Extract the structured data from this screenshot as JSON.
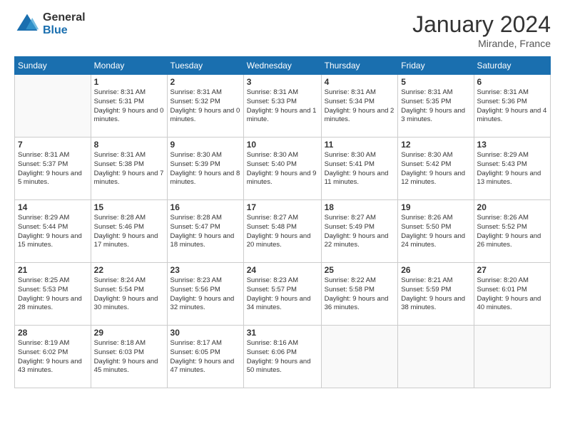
{
  "header": {
    "logo_general": "General",
    "logo_blue": "Blue",
    "month_title": "January 2024",
    "location": "Mirande, France"
  },
  "weekdays": [
    "Sunday",
    "Monday",
    "Tuesday",
    "Wednesday",
    "Thursday",
    "Friday",
    "Saturday"
  ],
  "weeks": [
    [
      {
        "day": "",
        "sunrise": "",
        "sunset": "",
        "daylight": ""
      },
      {
        "day": "1",
        "sunrise": "Sunrise: 8:31 AM",
        "sunset": "Sunset: 5:31 PM",
        "daylight": "Daylight: 9 hours and 0 minutes."
      },
      {
        "day": "2",
        "sunrise": "Sunrise: 8:31 AM",
        "sunset": "Sunset: 5:32 PM",
        "daylight": "Daylight: 9 hours and 0 minutes."
      },
      {
        "day": "3",
        "sunrise": "Sunrise: 8:31 AM",
        "sunset": "Sunset: 5:33 PM",
        "daylight": "Daylight: 9 hours and 1 minute."
      },
      {
        "day": "4",
        "sunrise": "Sunrise: 8:31 AM",
        "sunset": "Sunset: 5:34 PM",
        "daylight": "Daylight: 9 hours and 2 minutes."
      },
      {
        "day": "5",
        "sunrise": "Sunrise: 8:31 AM",
        "sunset": "Sunset: 5:35 PM",
        "daylight": "Daylight: 9 hours and 3 minutes."
      },
      {
        "day": "6",
        "sunrise": "Sunrise: 8:31 AM",
        "sunset": "Sunset: 5:36 PM",
        "daylight": "Daylight: 9 hours and 4 minutes."
      }
    ],
    [
      {
        "day": "7",
        "sunrise": "Sunrise: 8:31 AM",
        "sunset": "Sunset: 5:37 PM",
        "daylight": "Daylight: 9 hours and 5 minutes."
      },
      {
        "day": "8",
        "sunrise": "Sunrise: 8:31 AM",
        "sunset": "Sunset: 5:38 PM",
        "daylight": "Daylight: 9 hours and 7 minutes."
      },
      {
        "day": "9",
        "sunrise": "Sunrise: 8:30 AM",
        "sunset": "Sunset: 5:39 PM",
        "daylight": "Daylight: 9 hours and 8 minutes."
      },
      {
        "day": "10",
        "sunrise": "Sunrise: 8:30 AM",
        "sunset": "Sunset: 5:40 PM",
        "daylight": "Daylight: 9 hours and 9 minutes."
      },
      {
        "day": "11",
        "sunrise": "Sunrise: 8:30 AM",
        "sunset": "Sunset: 5:41 PM",
        "daylight": "Daylight: 9 hours and 11 minutes."
      },
      {
        "day": "12",
        "sunrise": "Sunrise: 8:30 AM",
        "sunset": "Sunset: 5:42 PM",
        "daylight": "Daylight: 9 hours and 12 minutes."
      },
      {
        "day": "13",
        "sunrise": "Sunrise: 8:29 AM",
        "sunset": "Sunset: 5:43 PM",
        "daylight": "Daylight: 9 hours and 13 minutes."
      }
    ],
    [
      {
        "day": "14",
        "sunrise": "Sunrise: 8:29 AM",
        "sunset": "Sunset: 5:44 PM",
        "daylight": "Daylight: 9 hours and 15 minutes."
      },
      {
        "day": "15",
        "sunrise": "Sunrise: 8:28 AM",
        "sunset": "Sunset: 5:46 PM",
        "daylight": "Daylight: 9 hours and 17 minutes."
      },
      {
        "day": "16",
        "sunrise": "Sunrise: 8:28 AM",
        "sunset": "Sunset: 5:47 PM",
        "daylight": "Daylight: 9 hours and 18 minutes."
      },
      {
        "day": "17",
        "sunrise": "Sunrise: 8:27 AM",
        "sunset": "Sunset: 5:48 PM",
        "daylight": "Daylight: 9 hours and 20 minutes."
      },
      {
        "day": "18",
        "sunrise": "Sunrise: 8:27 AM",
        "sunset": "Sunset: 5:49 PM",
        "daylight": "Daylight: 9 hours and 22 minutes."
      },
      {
        "day": "19",
        "sunrise": "Sunrise: 8:26 AM",
        "sunset": "Sunset: 5:50 PM",
        "daylight": "Daylight: 9 hours and 24 minutes."
      },
      {
        "day": "20",
        "sunrise": "Sunrise: 8:26 AM",
        "sunset": "Sunset: 5:52 PM",
        "daylight": "Daylight: 9 hours and 26 minutes."
      }
    ],
    [
      {
        "day": "21",
        "sunrise": "Sunrise: 8:25 AM",
        "sunset": "Sunset: 5:53 PM",
        "daylight": "Daylight: 9 hours and 28 minutes."
      },
      {
        "day": "22",
        "sunrise": "Sunrise: 8:24 AM",
        "sunset": "Sunset: 5:54 PM",
        "daylight": "Daylight: 9 hours and 30 minutes."
      },
      {
        "day": "23",
        "sunrise": "Sunrise: 8:23 AM",
        "sunset": "Sunset: 5:56 PM",
        "daylight": "Daylight: 9 hours and 32 minutes."
      },
      {
        "day": "24",
        "sunrise": "Sunrise: 8:23 AM",
        "sunset": "Sunset: 5:57 PM",
        "daylight": "Daylight: 9 hours and 34 minutes."
      },
      {
        "day": "25",
        "sunrise": "Sunrise: 8:22 AM",
        "sunset": "Sunset: 5:58 PM",
        "daylight": "Daylight: 9 hours and 36 minutes."
      },
      {
        "day": "26",
        "sunrise": "Sunrise: 8:21 AM",
        "sunset": "Sunset: 5:59 PM",
        "daylight": "Daylight: 9 hours and 38 minutes."
      },
      {
        "day": "27",
        "sunrise": "Sunrise: 8:20 AM",
        "sunset": "Sunset: 6:01 PM",
        "daylight": "Daylight: 9 hours and 40 minutes."
      }
    ],
    [
      {
        "day": "28",
        "sunrise": "Sunrise: 8:19 AM",
        "sunset": "Sunset: 6:02 PM",
        "daylight": "Daylight: 9 hours and 43 minutes."
      },
      {
        "day": "29",
        "sunrise": "Sunrise: 8:18 AM",
        "sunset": "Sunset: 6:03 PM",
        "daylight": "Daylight: 9 hours and 45 minutes."
      },
      {
        "day": "30",
        "sunrise": "Sunrise: 8:17 AM",
        "sunset": "Sunset: 6:05 PM",
        "daylight": "Daylight: 9 hours and 47 minutes."
      },
      {
        "day": "31",
        "sunrise": "Sunrise: 8:16 AM",
        "sunset": "Sunset: 6:06 PM",
        "daylight": "Daylight: 9 hours and 50 minutes."
      },
      {
        "day": "",
        "sunrise": "",
        "sunset": "",
        "daylight": ""
      },
      {
        "day": "",
        "sunrise": "",
        "sunset": "",
        "daylight": ""
      },
      {
        "day": "",
        "sunrise": "",
        "sunset": "",
        "daylight": ""
      }
    ]
  ]
}
